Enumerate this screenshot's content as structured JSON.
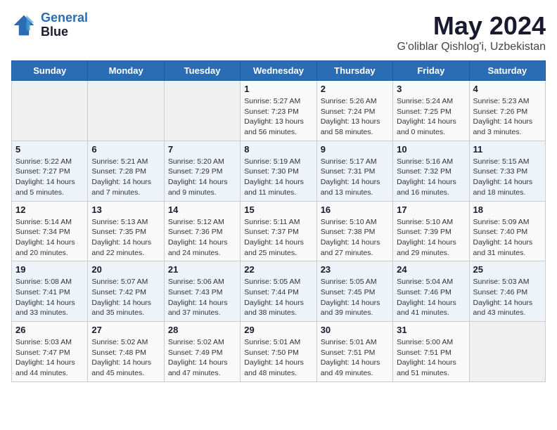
{
  "header": {
    "logo_line1": "General",
    "logo_line2": "Blue",
    "title": "May 2024",
    "subtitle": "G'oliblar Qishlog'i, Uzbekistan"
  },
  "weekdays": [
    "Sunday",
    "Monday",
    "Tuesday",
    "Wednesday",
    "Thursday",
    "Friday",
    "Saturday"
  ],
  "weeks": [
    [
      {
        "day": "",
        "info": ""
      },
      {
        "day": "",
        "info": ""
      },
      {
        "day": "",
        "info": ""
      },
      {
        "day": "1",
        "info": "Sunrise: 5:27 AM\nSunset: 7:23 PM\nDaylight: 13 hours and 56 minutes."
      },
      {
        "day": "2",
        "info": "Sunrise: 5:26 AM\nSunset: 7:24 PM\nDaylight: 13 hours and 58 minutes."
      },
      {
        "day": "3",
        "info": "Sunrise: 5:24 AM\nSunset: 7:25 PM\nDaylight: 14 hours and 0 minutes."
      },
      {
        "day": "4",
        "info": "Sunrise: 5:23 AM\nSunset: 7:26 PM\nDaylight: 14 hours and 3 minutes."
      }
    ],
    [
      {
        "day": "5",
        "info": "Sunrise: 5:22 AM\nSunset: 7:27 PM\nDaylight: 14 hours and 5 minutes."
      },
      {
        "day": "6",
        "info": "Sunrise: 5:21 AM\nSunset: 7:28 PM\nDaylight: 14 hours and 7 minutes."
      },
      {
        "day": "7",
        "info": "Sunrise: 5:20 AM\nSunset: 7:29 PM\nDaylight: 14 hours and 9 minutes."
      },
      {
        "day": "8",
        "info": "Sunrise: 5:19 AM\nSunset: 7:30 PM\nDaylight: 14 hours and 11 minutes."
      },
      {
        "day": "9",
        "info": "Sunrise: 5:17 AM\nSunset: 7:31 PM\nDaylight: 14 hours and 13 minutes."
      },
      {
        "day": "10",
        "info": "Sunrise: 5:16 AM\nSunset: 7:32 PM\nDaylight: 14 hours and 16 minutes."
      },
      {
        "day": "11",
        "info": "Sunrise: 5:15 AM\nSunset: 7:33 PM\nDaylight: 14 hours and 18 minutes."
      }
    ],
    [
      {
        "day": "12",
        "info": "Sunrise: 5:14 AM\nSunset: 7:34 PM\nDaylight: 14 hours and 20 minutes."
      },
      {
        "day": "13",
        "info": "Sunrise: 5:13 AM\nSunset: 7:35 PM\nDaylight: 14 hours and 22 minutes."
      },
      {
        "day": "14",
        "info": "Sunrise: 5:12 AM\nSunset: 7:36 PM\nDaylight: 14 hours and 24 minutes."
      },
      {
        "day": "15",
        "info": "Sunrise: 5:11 AM\nSunset: 7:37 PM\nDaylight: 14 hours and 25 minutes."
      },
      {
        "day": "16",
        "info": "Sunrise: 5:10 AM\nSunset: 7:38 PM\nDaylight: 14 hours and 27 minutes."
      },
      {
        "day": "17",
        "info": "Sunrise: 5:10 AM\nSunset: 7:39 PM\nDaylight: 14 hours and 29 minutes."
      },
      {
        "day": "18",
        "info": "Sunrise: 5:09 AM\nSunset: 7:40 PM\nDaylight: 14 hours and 31 minutes."
      }
    ],
    [
      {
        "day": "19",
        "info": "Sunrise: 5:08 AM\nSunset: 7:41 PM\nDaylight: 14 hours and 33 minutes."
      },
      {
        "day": "20",
        "info": "Sunrise: 5:07 AM\nSunset: 7:42 PM\nDaylight: 14 hours and 35 minutes."
      },
      {
        "day": "21",
        "info": "Sunrise: 5:06 AM\nSunset: 7:43 PM\nDaylight: 14 hours and 37 minutes."
      },
      {
        "day": "22",
        "info": "Sunrise: 5:05 AM\nSunset: 7:44 PM\nDaylight: 14 hours and 38 minutes."
      },
      {
        "day": "23",
        "info": "Sunrise: 5:05 AM\nSunset: 7:45 PM\nDaylight: 14 hours and 39 minutes."
      },
      {
        "day": "24",
        "info": "Sunrise: 5:04 AM\nSunset: 7:46 PM\nDaylight: 14 hours and 41 minutes."
      },
      {
        "day": "25",
        "info": "Sunrise: 5:03 AM\nSunset: 7:46 PM\nDaylight: 14 hours and 43 minutes."
      }
    ],
    [
      {
        "day": "26",
        "info": "Sunrise: 5:03 AM\nSunset: 7:47 PM\nDaylight: 14 hours and 44 minutes."
      },
      {
        "day": "27",
        "info": "Sunrise: 5:02 AM\nSunset: 7:48 PM\nDaylight: 14 hours and 45 minutes."
      },
      {
        "day": "28",
        "info": "Sunrise: 5:02 AM\nSunset: 7:49 PM\nDaylight: 14 hours and 47 minutes."
      },
      {
        "day": "29",
        "info": "Sunrise: 5:01 AM\nSunset: 7:50 PM\nDaylight: 14 hours and 48 minutes."
      },
      {
        "day": "30",
        "info": "Sunrise: 5:01 AM\nSunset: 7:51 PM\nDaylight: 14 hours and 49 minutes."
      },
      {
        "day": "31",
        "info": "Sunrise: 5:00 AM\nSunset: 7:51 PM\nDaylight: 14 hours and 51 minutes."
      },
      {
        "day": "",
        "info": ""
      }
    ]
  ]
}
